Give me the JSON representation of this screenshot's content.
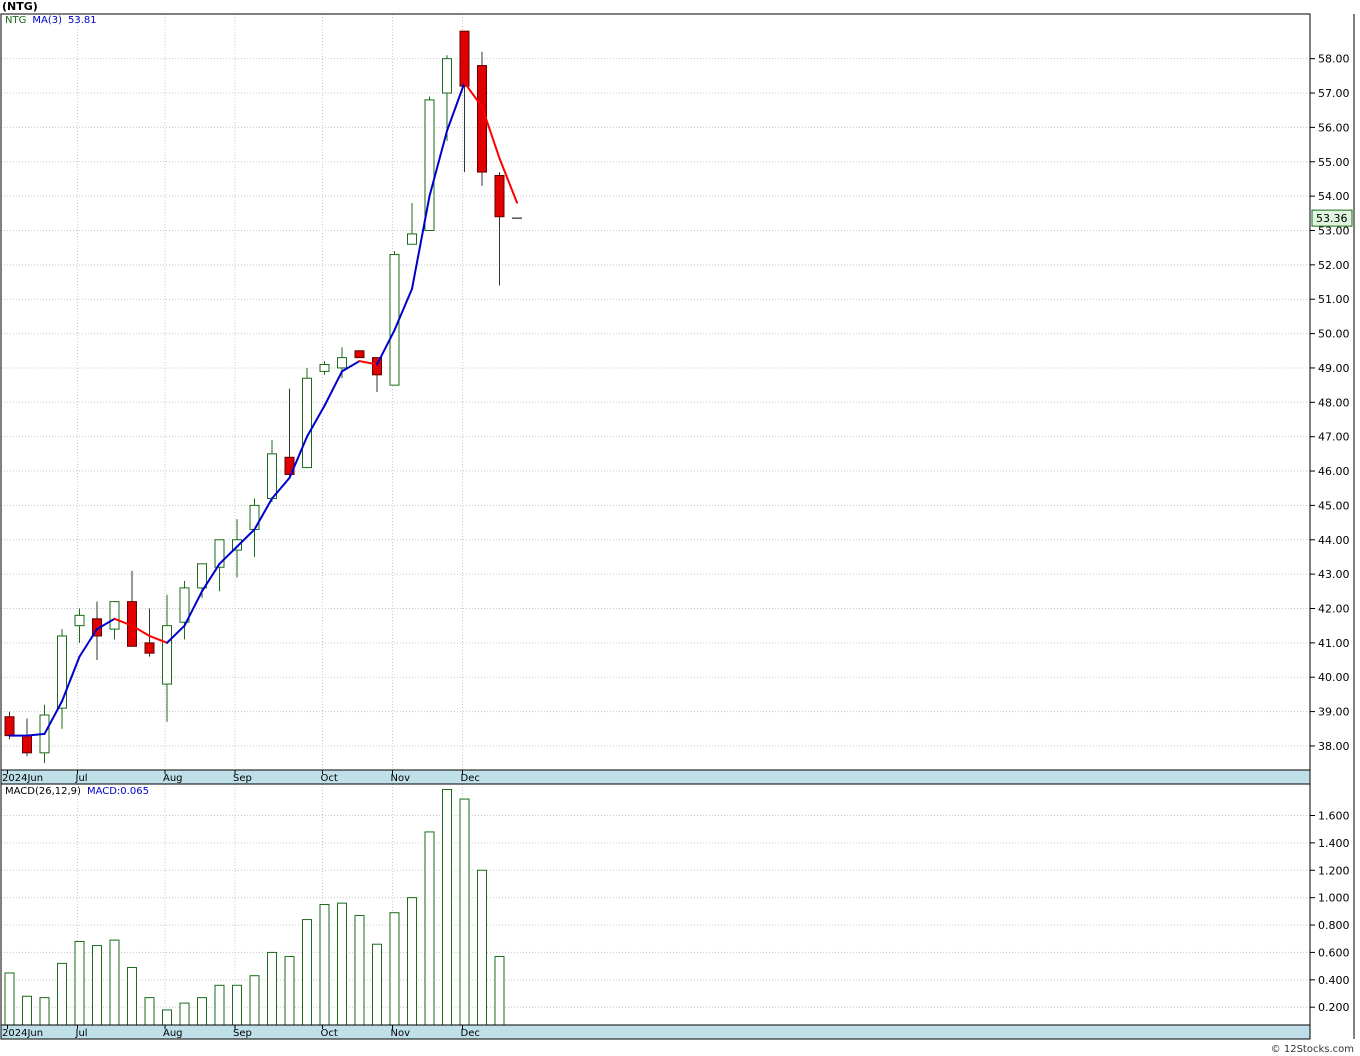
{
  "page": {
    "title": "(NTG)",
    "copyright": "© 12Stocks.com"
  },
  "price_legend": {
    "symbol": "NTG",
    "ma_label": "MA(3)",
    "ma_value": "53.81"
  },
  "macd_legend": {
    "label": "MACD(26,12,9)",
    "value_label": "MACD:0.065"
  },
  "current_price_label": "53.36",
  "colors": {
    "up_candle": "#1a6b1a",
    "down_candle": "#e00000",
    "ma_up": "#0000cc",
    "ma_down": "#ff0000",
    "axis_band": "#bfe0e8",
    "grid": "#c8c8c8",
    "price_tag_bg": "#dff5df",
    "price_tag_border": "#1a6b1a"
  },
  "chart_data": [
    {
      "type": "candlestick",
      "name": "price",
      "ylim": [
        37.3,
        59.3
      ],
      "y_ticks": [
        38,
        39,
        40,
        41,
        42,
        43,
        44,
        45,
        46,
        47,
        48,
        49,
        50,
        51,
        52,
        53,
        54,
        55,
        56,
        57,
        58
      ],
      "x_tick_labels": [
        {
          "label": "2024Jun",
          "bar": 0
        },
        {
          "label": "Jul",
          "bar": 4
        },
        {
          "label": "Aug",
          "bar": 9
        },
        {
          "label": "Sep",
          "bar": 13
        },
        {
          "label": "Oct",
          "bar": 18
        },
        {
          "label": "Nov",
          "bar": 22
        },
        {
          "label": "Dec",
          "bar": 26
        }
      ],
      "grid": true,
      "bars": [
        {
          "o": 38.85,
          "h": 39.0,
          "l": 38.2,
          "c": 38.3
        },
        {
          "o": 38.3,
          "h": 38.8,
          "l": 37.7,
          "c": 37.8
        },
        {
          "o": 37.8,
          "h": 39.2,
          "l": 37.5,
          "c": 38.9
        },
        {
          "o": 39.1,
          "h": 41.4,
          "l": 38.5,
          "c": 41.2
        },
        {
          "o": 41.5,
          "h": 42.0,
          "l": 41.0,
          "c": 41.8
        },
        {
          "o": 41.7,
          "h": 42.2,
          "l": 40.5,
          "c": 41.2
        },
        {
          "o": 41.4,
          "h": 42.2,
          "l": 41.1,
          "c": 42.2
        },
        {
          "o": 42.2,
          "h": 43.1,
          "l": 40.9,
          "c": 40.9
        },
        {
          "o": 41.0,
          "h": 42.0,
          "l": 40.6,
          "c": 40.7
        },
        {
          "o": 39.8,
          "h": 42.4,
          "l": 38.7,
          "c": 41.5
        },
        {
          "o": 41.6,
          "h": 42.8,
          "l": 41.1,
          "c": 42.6
        },
        {
          "o": 42.6,
          "h": 43.3,
          "l": 42.3,
          "c": 43.3
        },
        {
          "o": 43.2,
          "h": 44.0,
          "l": 42.5,
          "c": 44.0
        },
        {
          "o": 43.7,
          "h": 44.6,
          "l": 42.9,
          "c": 44.0
        },
        {
          "o": 44.3,
          "h": 45.2,
          "l": 43.5,
          "c": 45.0
        },
        {
          "o": 45.2,
          "h": 46.9,
          "l": 45.1,
          "c": 46.5
        },
        {
          "o": 46.4,
          "h": 48.4,
          "l": 45.8,
          "c": 45.9
        },
        {
          "o": 46.1,
          "h": 49.0,
          "l": 46.1,
          "c": 48.7
        },
        {
          "o": 48.9,
          "h": 49.2,
          "l": 48.8,
          "c": 49.1
        },
        {
          "o": 49.0,
          "h": 49.6,
          "l": 48.7,
          "c": 49.3
        },
        {
          "o": 49.5,
          "h": 49.5,
          "l": 49.3,
          "c": 49.3
        },
        {
          "o": 49.3,
          "h": 49.3,
          "l": 48.3,
          "c": 48.8
        },
        {
          "o": 48.5,
          "h": 52.4,
          "l": 48.5,
          "c": 52.3
        },
        {
          "o": 52.6,
          "h": 53.8,
          "l": 52.6,
          "c": 52.9
        },
        {
          "o": 53.0,
          "h": 56.9,
          "l": 53.0,
          "c": 56.8
        },
        {
          "o": 57.0,
          "h": 58.1,
          "l": 55.6,
          "c": 58.0
        },
        {
          "o": 58.8,
          "h": 58.8,
          "l": 54.7,
          "c": 57.2
        },
        {
          "o": 57.8,
          "h": 58.2,
          "l": 54.3,
          "c": 54.7
        },
        {
          "o": 54.6,
          "h": 54.7,
          "l": 51.4,
          "c": 53.4
        },
        {
          "o": 53.36,
          "h": 53.36,
          "l": 53.36,
          "c": 53.36
        }
      ],
      "ma3": [
        38.3,
        38.3,
        38.35,
        39.3,
        40.6,
        41.4,
        41.7,
        41.5,
        41.2,
        41.0,
        41.5,
        42.5,
        43.3,
        43.8,
        44.3,
        45.2,
        45.8,
        47.0,
        47.9,
        48.9,
        49.2,
        49.1,
        50.1,
        51.3,
        54.0,
        55.9,
        57.3,
        56.6,
        55.1,
        53.81
      ]
    },
    {
      "type": "bar",
      "name": "MACD(26,12,9)",
      "ylim": [
        0.07,
        1.83
      ],
      "y_ticks": [
        0.2,
        0.4,
        0.6,
        0.8,
        1.0,
        1.2,
        1.4,
        1.6
      ],
      "y_tick_labels": [
        "0.200",
        "0.400",
        "0.600",
        "0.800",
        "1.000",
        "1.200",
        "1.400",
        "1.600"
      ],
      "x_tick_labels": [
        {
          "label": "2024Jun",
          "bar": 0
        },
        {
          "label": "Jul",
          "bar": 4
        },
        {
          "label": "Aug",
          "bar": 9
        },
        {
          "label": "Sep",
          "bar": 13
        },
        {
          "label": "Oct",
          "bar": 18
        },
        {
          "label": "Nov",
          "bar": 22
        },
        {
          "label": "Dec",
          "bar": 26
        }
      ],
      "grid": true,
      "values": [
        0.45,
        0.28,
        0.27,
        0.52,
        0.68,
        0.65,
        0.69,
        0.49,
        0.27,
        0.18,
        0.23,
        0.27,
        0.36,
        0.36,
        0.43,
        0.6,
        0.57,
        0.84,
        0.95,
        0.96,
        0.87,
        0.66,
        0.89,
        1.0,
        1.48,
        1.79,
        1.72,
        1.2,
        0.57
      ]
    }
  ]
}
